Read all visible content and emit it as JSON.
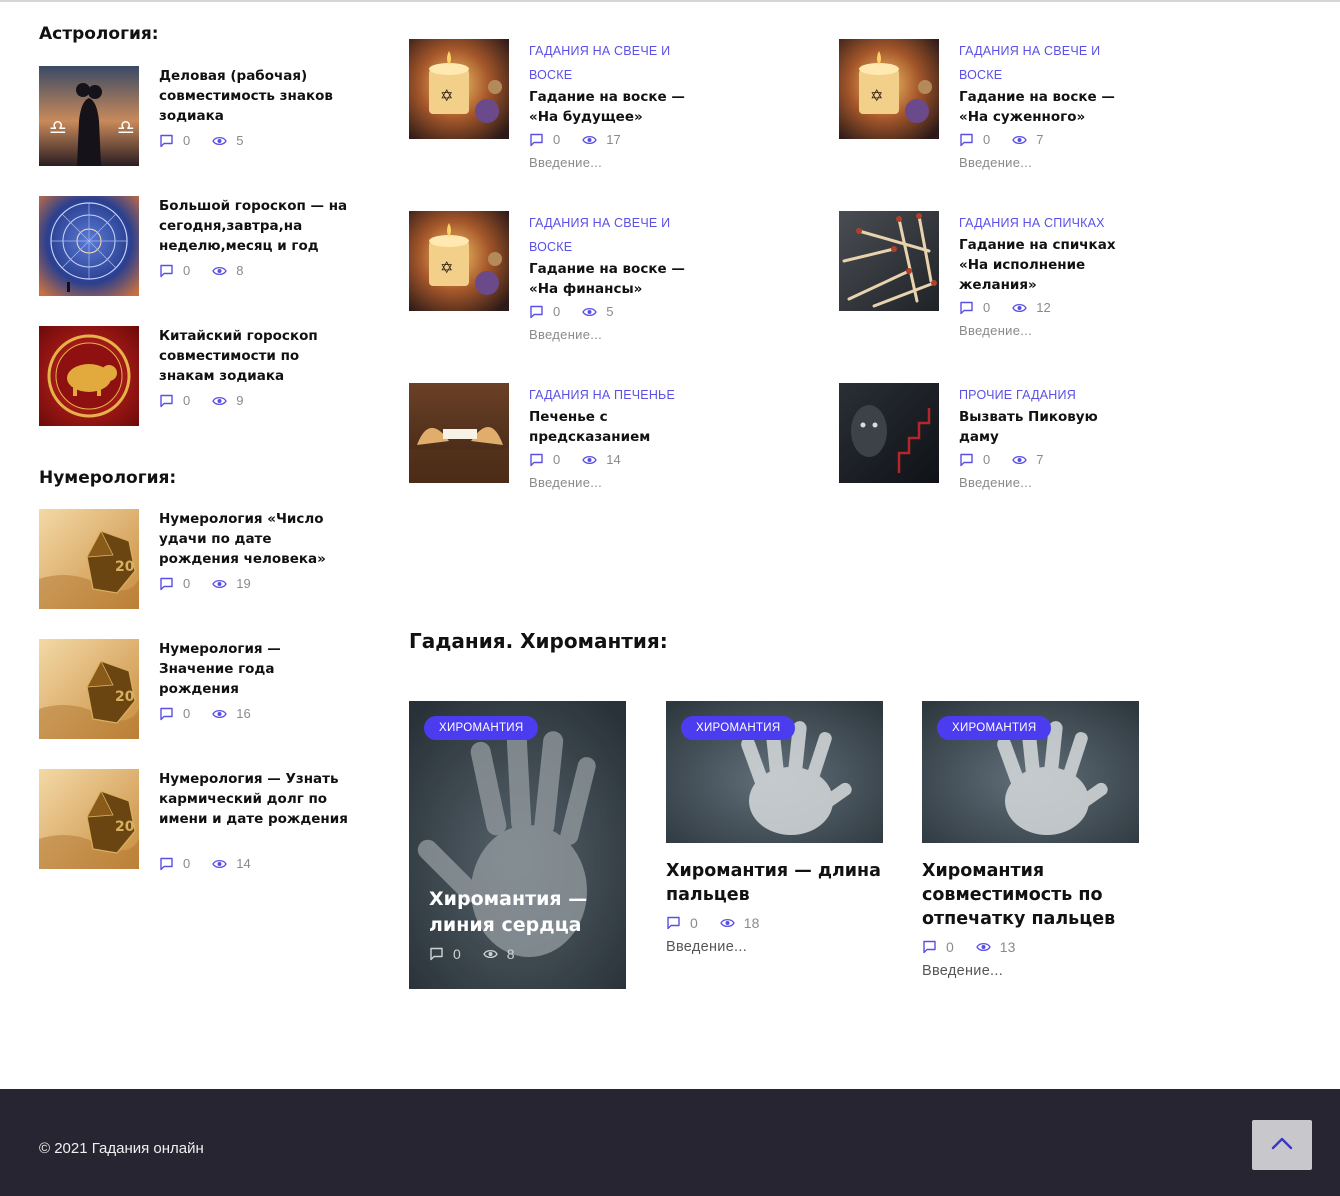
{
  "sidebar": {
    "astrology_heading": "Астрология:",
    "astrology": [
      {
        "title": "Деловая (рабочая) совместимость знаков зодиака",
        "comments": "0",
        "views": "5",
        "thumb": "couple-zodiac"
      },
      {
        "title": "Большой гороскоп — на сегодня,завтра,на неделю,месяц и год",
        "comments": "0",
        "views": "8",
        "thumb": "zodiac-wheel"
      },
      {
        "title": "Китайский гороскоп совместимости по знакам зодиака",
        "comments": "0",
        "views": "9",
        "thumb": "golden-pig"
      }
    ],
    "numerology_heading": "Нумерология:",
    "numerology": [
      {
        "title": "Нумерология «Число удачи по дате рождения человека»",
        "comments": "0",
        "views": "19",
        "thumb": "dice-20"
      },
      {
        "title": "Нумерология — Значение года рождения",
        "comments": "0",
        "views": "16",
        "thumb": "dice-20"
      },
      {
        "title": "Нумерология — Узнать кармический долг по имени и дате рождения",
        "comments": "0",
        "views": "14",
        "thumb": "dice-20"
      }
    ]
  },
  "divination_list": [
    {
      "category": "ГАДАНИЯ НА СВЕЧЕ И ВОСКЕ",
      "title": "Гадание на воске — «На будущее»",
      "comments": "0",
      "views": "17",
      "excerpt": "Введение...",
      "thumb": "candle"
    },
    {
      "category": "ГАДАНИЯ НА СВЕЧЕ И ВОСКЕ",
      "title": "Гадание на воске — «На суженного»",
      "comments": "0",
      "views": "7",
      "excerpt": "Введение...",
      "thumb": "candle"
    },
    {
      "category": "ГАДАНИЯ НА СВЕЧЕ И ВОСКЕ",
      "title": "Гадание на воске — «На финансы»",
      "comments": "0",
      "views": "5",
      "excerpt": "Введение...",
      "thumb": "candle"
    },
    {
      "category": "ГАДАНИЯ НА СПИЧКАХ",
      "title": "Гадание на спичках «На исполнение желания»",
      "comments": "0",
      "views": "12",
      "excerpt": "Введение...",
      "thumb": "matches"
    },
    {
      "category": "ГАДАНИЯ НА ПЕЧЕНЬЕ",
      "title": "Печенье с предсказанием",
      "comments": "0",
      "views": "14",
      "excerpt": "Введение...",
      "thumb": "fortune-cookie"
    },
    {
      "category": "ПРОЧИЕ ГАДАНИЯ",
      "title": "Вызвать Пиковую даму",
      "comments": "0",
      "views": "7",
      "excerpt": "Введение...",
      "thumb": "dark-face"
    }
  ],
  "palmistry": {
    "heading": "Гадания. Хиромантия:",
    "cards": [
      {
        "badge": "ХИРОМАНТИЯ",
        "title": "Хиромантия — линия сердца",
        "comments": "0",
        "views": "8",
        "excerpt": ""
      },
      {
        "badge": "ХИРОМАНТИЯ",
        "title": "Хиромантия — длина пальцев",
        "comments": "0",
        "views": "18",
        "excerpt": "Введение..."
      },
      {
        "badge": "ХИРОМАНТИЯ",
        "title": "Хиромантия совместимость по отпечатку пальцев",
        "comments": "0",
        "views": "13",
        "excerpt": "Введение..."
      }
    ]
  },
  "footer": {
    "copyright": "© 2021 Гадания онлайн",
    "to_top_icon": "chevron-up-icon"
  },
  "colors": {
    "accent": "#5a50e6",
    "badge": "#4b3cf0",
    "footer_bg": "#262531",
    "to_top_bg": "#c8c8cc"
  }
}
